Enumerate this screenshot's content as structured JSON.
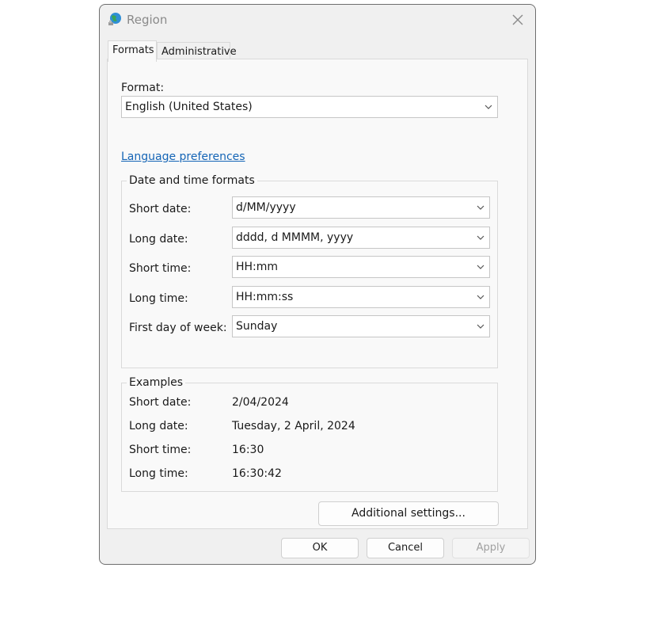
{
  "window": {
    "title": "Region",
    "icon": "globe-icon",
    "close_icon": "close-icon"
  },
  "tabs": [
    {
      "label": "Formats",
      "active": true
    },
    {
      "label": "Administrative",
      "active": false
    }
  ],
  "format": {
    "label": "Format:",
    "value": "English (United States)"
  },
  "language_link": "Language preferences",
  "datetime": {
    "title": "Date and time formats",
    "rows": [
      {
        "label": "Short date:",
        "value": "d/MM/yyyy"
      },
      {
        "label": "Long date:",
        "value": "dddd, d MMMM, yyyy"
      },
      {
        "label": "Short time:",
        "value": "HH:mm"
      },
      {
        "label": "Long time:",
        "value": "HH:mm:ss"
      },
      {
        "label": "First day of week:",
        "value": "Sunday"
      }
    ]
  },
  "examples": {
    "title": "Examples",
    "rows": [
      {
        "label": "Short date:",
        "value": "2/04/2024"
      },
      {
        "label": "Long date:",
        "value": "Tuesday, 2 April, 2024"
      },
      {
        "label": "Short time:",
        "value": "16:30"
      },
      {
        "label": "Long time:",
        "value": "16:30:42"
      }
    ]
  },
  "buttons": {
    "additional": "Additional settings...",
    "ok": "OK",
    "cancel": "Cancel",
    "apply": "Apply"
  },
  "colors": {
    "link": "#1565b6",
    "dialog_bg": "#f0f0f0",
    "panel_bg": "#f9f9f9"
  }
}
